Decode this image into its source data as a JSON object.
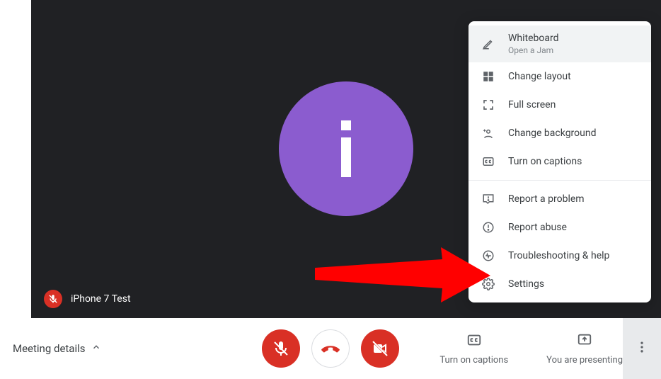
{
  "participant": {
    "name": "iPhone 7 Test"
  },
  "avatar": {
    "letter": "i"
  },
  "bottom": {
    "meeting_details": "Meeting details",
    "captions": "Turn on captions",
    "presenting": "You are presenting"
  },
  "menu": {
    "whiteboard": {
      "label": "Whiteboard",
      "sub": "Open a Jam"
    },
    "layout": "Change layout",
    "fullscreen": "Full screen",
    "background": "Change background",
    "captions": "Turn on captions",
    "report_problem": "Report a problem",
    "report_abuse": "Report abuse",
    "troubleshoot": "Troubleshooting & help",
    "settings": "Settings"
  }
}
